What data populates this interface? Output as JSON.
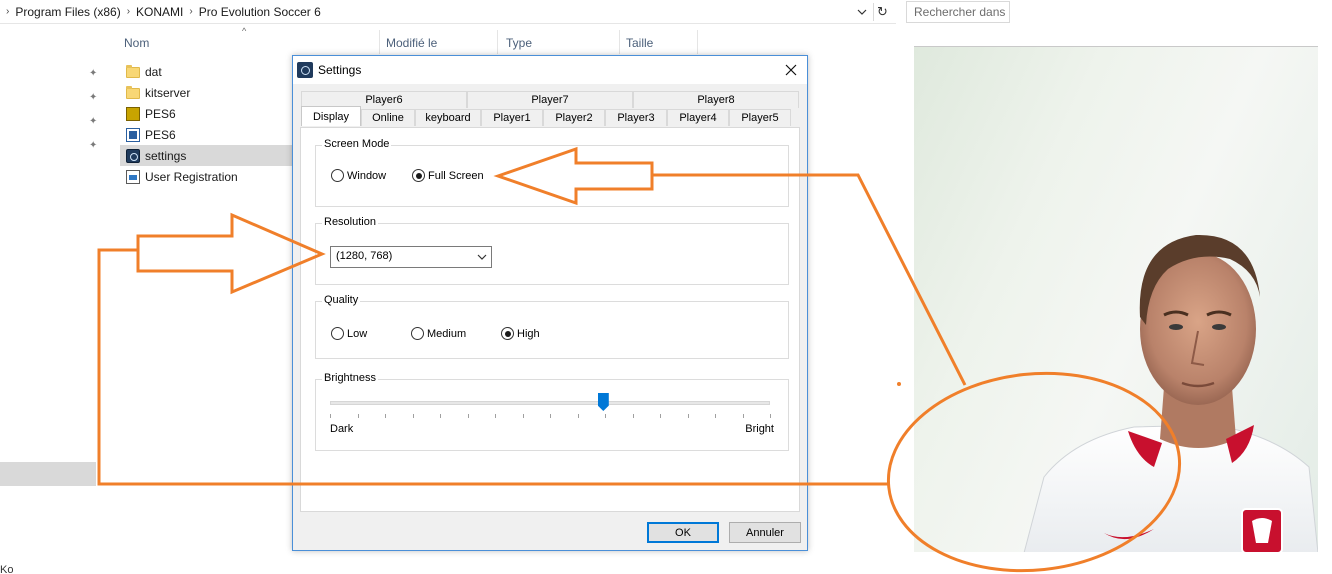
{
  "explorer": {
    "breadcrumbs": [
      "Program Files (x86)",
      "KONAMI",
      "Pro Evolution Soccer 6"
    ],
    "search_placeholder": "Rechercher dans :",
    "columns": [
      "Nom",
      "Modifié le",
      "Type",
      "Taille"
    ],
    "files": [
      {
        "name": "dat",
        "icon": "folder-icon"
      },
      {
        "name": "kitserver",
        "icon": "folder-icon"
      },
      {
        "name": "PES6",
        "icon": "pes6-app-icon"
      },
      {
        "name": "PES6",
        "icon": "pes6-image-icon"
      },
      {
        "name": "settings",
        "icon": "settings-app-icon",
        "selected": true
      },
      {
        "name": "User Registration",
        "icon": "registration-doc-icon"
      }
    ],
    "stray_text": "Ko"
  },
  "dialog": {
    "title": "Settings",
    "tabs_back": [
      "Player6",
      "Player7",
      "Player8"
    ],
    "tabs_front": [
      "Display",
      "Online",
      "keyboard",
      "Player1",
      "Player2",
      "Player3",
      "Player4",
      "Player5"
    ],
    "active_tab": "Display",
    "screen_mode": {
      "label": "Screen Mode",
      "options": [
        "Window",
        "Full Screen"
      ],
      "selected": "Full Screen"
    },
    "resolution": {
      "label": "Resolution",
      "value": "(1280, 768)"
    },
    "quality": {
      "label": "Quality",
      "options": [
        "Low",
        "Medium",
        "High"
      ],
      "selected": "High"
    },
    "brightness": {
      "label": "Brightness",
      "min_label": "Dark",
      "max_label": "Bright",
      "level": 0.62
    },
    "ok_label": "OK",
    "cancel_label": "Annuler"
  },
  "colors": {
    "annotation": "#f07f2a",
    "accent": "#0078d7",
    "selection": "#d9d9d9"
  }
}
